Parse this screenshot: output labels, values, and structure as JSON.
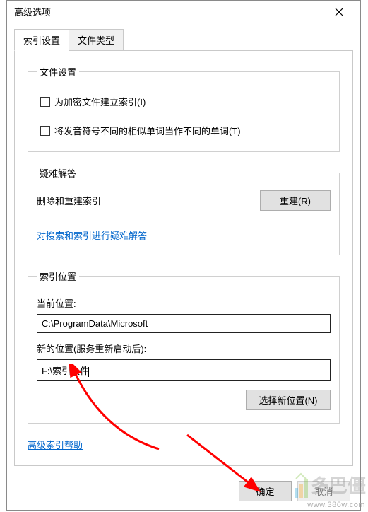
{
  "window": {
    "title": "高级选项"
  },
  "tabs": {
    "index_settings": "索引设置",
    "file_types": "文件类型"
  },
  "file_settings": {
    "legend": "文件设置",
    "encrypt_label": "为加密文件建立索引(I)",
    "phonetic_label": "将发音符号不同的相似单词当作不同的单词(T)"
  },
  "troubleshoot": {
    "legend": "疑难解答",
    "delete_rebuild_text": "删除和重建索引",
    "rebuild_button": "重建(R)",
    "search_link": "对搜索和索引进行疑难解答"
  },
  "index_location": {
    "legend": "索引位置",
    "current_label": "当前位置:",
    "current_value": "C:\\ProgramData\\Microsoft",
    "new_label": "新的位置(服务重新启动后):",
    "new_value": "F:\\索引文件",
    "select_button": "选择新位置(N)"
  },
  "help_link": "高级索引帮助",
  "buttons": {
    "ok": "确定",
    "cancel": "取消"
  },
  "watermark": {
    "text": "多巴僵",
    "url": "www.386w.com"
  }
}
